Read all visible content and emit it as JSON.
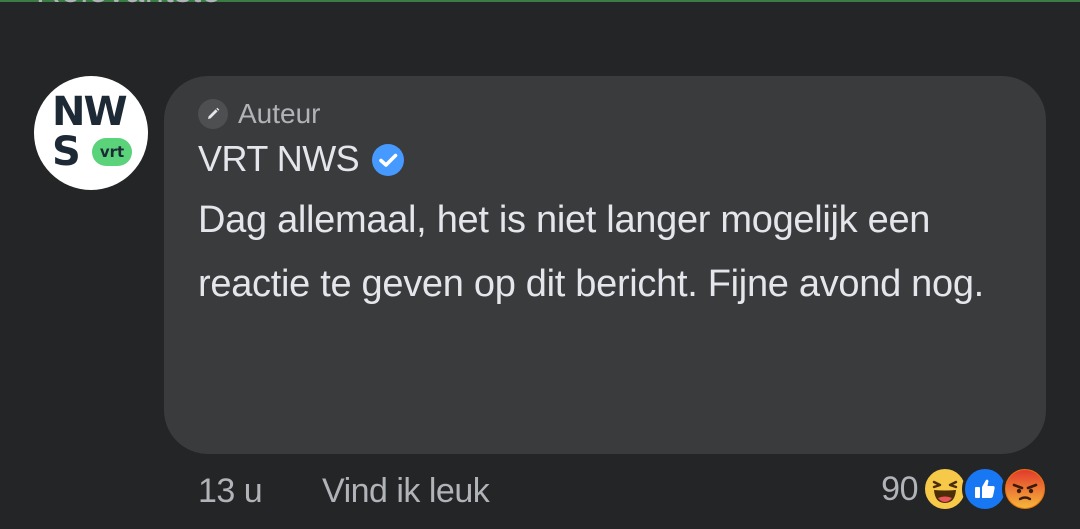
{
  "previous_heading": "Relevantste",
  "comment": {
    "author_tag": "Auteur",
    "author_name": "VRT NWS",
    "avatar": {
      "line1": "NW",
      "line2": "S",
      "pill": "vrt"
    },
    "text": "Dag allemaal, het is niet langer mogelijk een reactie te geven op dit bericht. Fijne avond nog.",
    "time": "13 u",
    "like_label": "Vind ik leuk",
    "reaction_count": "90",
    "reactions": [
      "haha-icon",
      "like-icon",
      "angry-icon"
    ]
  },
  "colors": {
    "background": "#242526",
    "bubble": "#3a3b3c",
    "verified_blue": "#4599ff",
    "like_blue": "#1877f2",
    "haha_yellow": "#f7c948",
    "angry_orange": "#e9710f"
  }
}
